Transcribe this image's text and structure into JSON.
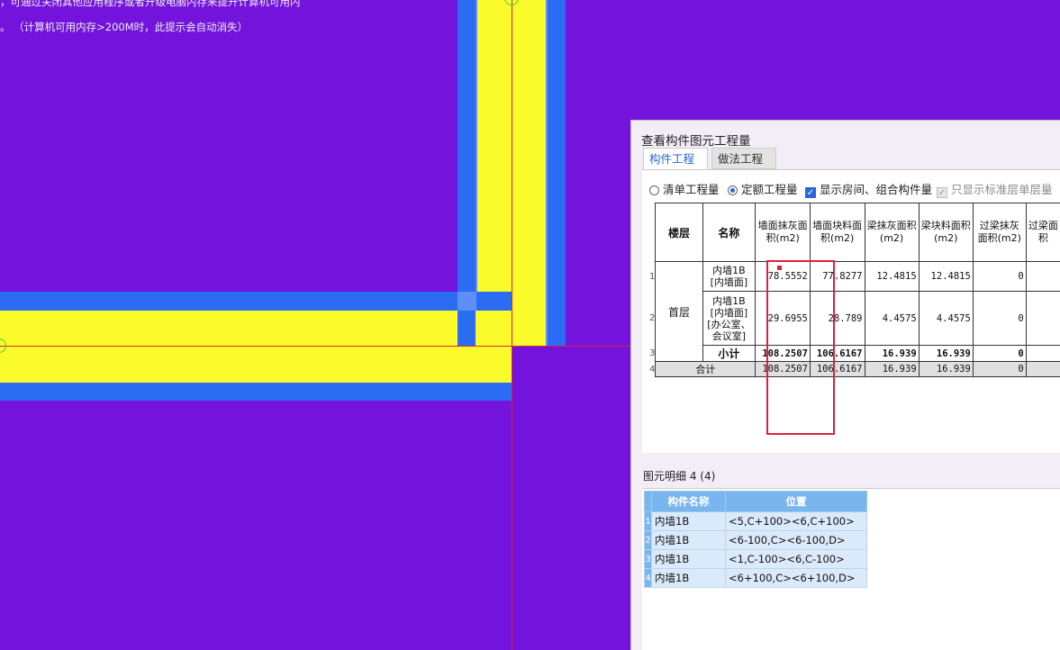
{
  "canvas_message": {
    "line1": "，可通过关闭其他应用程序或者升级电脑内存来提升计算机可用内",
    "line2": "。 （计算机可用内存>200M时，此提示会自动消失）"
  },
  "dialog": {
    "title": "查看构件图元工程量",
    "tabs": [
      "构件工程量",
      "做法工程量"
    ],
    "options": {
      "radio1": "清单工程量",
      "radio2": "定额工程量",
      "check1": "显示房间、组合构件量",
      "check2": "只显示标准层单层量"
    },
    "table": {
      "headers": [
        "楼层",
        "名称",
        "墙面抹灰面积(m2)",
        "墙面块料面积(m2)",
        "梁抹灰面积(m2)",
        "梁块料面积(m2)",
        "过梁抹灰面积(m2)",
        "过梁面积"
      ],
      "row_indices": [
        "1",
        "2",
        "3",
        "4"
      ],
      "floor": "首层",
      "rows": [
        {
          "name": "内墙1B [内墙面]",
          "values": [
            "78.5552",
            "77.8277",
            "12.4815",
            "12.4815",
            "0"
          ]
        },
        {
          "name": "内墙1B [内墙面][办公室、会议室]",
          "values": [
            "29.6955",
            "28.789",
            "4.4575",
            "4.4575",
            "0"
          ]
        }
      ],
      "subtotal": {
        "label": "小计",
        "values": [
          "108.2507",
          "106.6167",
          "16.939",
          "16.939",
          "0"
        ]
      },
      "total": {
        "label": "合计",
        "values": [
          "108.2507",
          "106.6167",
          "16.939",
          "16.939",
          "0"
        ]
      }
    },
    "detail": {
      "label": "图元明细",
      "count": "4 (4)",
      "headers": [
        "构件名称",
        "位置"
      ],
      "rows": [
        {
          "index": "1",
          "name": "内墙1B",
          "position": "<5,C+100><6,C+100>"
        },
        {
          "index": "2",
          "name": "内墙1B",
          "position": "<6-100,C><6-100,D>"
        },
        {
          "index": "3",
          "name": "内墙1B",
          "position": "<1,C-100><6,C-100>"
        },
        {
          "index": "4",
          "name": "内墙1B",
          "position": "<6+100,C><6+100,D>"
        }
      ]
    }
  },
  "colors": {
    "canvas_bg": "#7413dc",
    "wall_fill": "#fbfb2c",
    "wall_edge": "#2b6cf2",
    "highlight": "#e0213a",
    "detail_header": "#7ab6ee"
  }
}
